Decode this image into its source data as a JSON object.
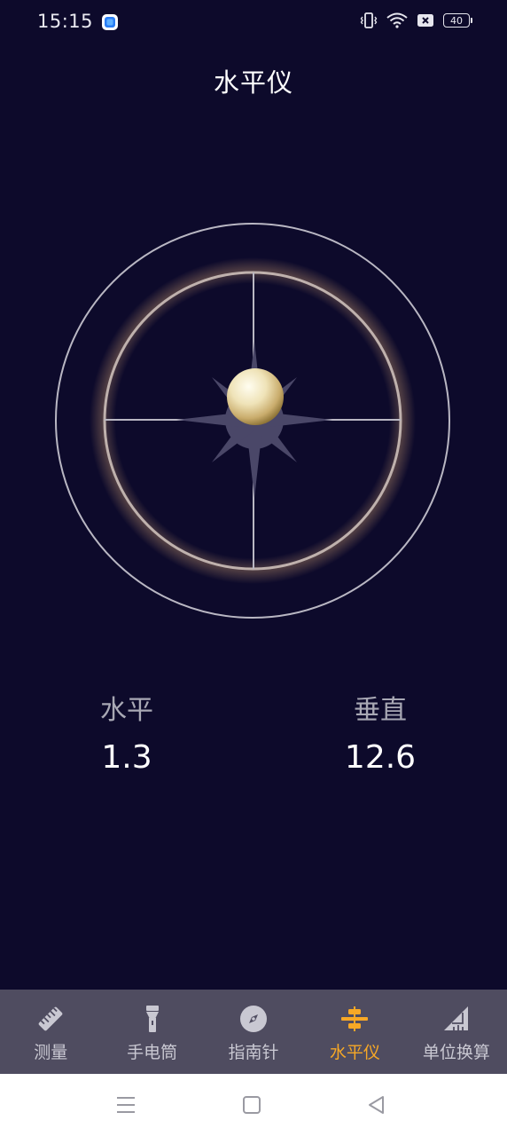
{
  "status_bar": {
    "time": "15:15",
    "battery": "40"
  },
  "page": {
    "title": "水平仪"
  },
  "readouts": {
    "horizontal": {
      "label": "水平",
      "value": "1.3"
    },
    "vertical": {
      "label": "垂直",
      "value": "12.6"
    }
  },
  "tabs": [
    {
      "label": "测量",
      "icon": "ruler-icon",
      "active": false
    },
    {
      "label": "手电筒",
      "icon": "flashlight-icon",
      "active": false
    },
    {
      "label": "指南针",
      "icon": "compass-icon",
      "active": false
    },
    {
      "label": "水平仪",
      "icon": "level-icon",
      "active": true
    },
    {
      "label": "单位换算",
      "icon": "unit-convert-icon",
      "active": false
    }
  ],
  "colors": {
    "background": "#0d0a2b",
    "tab_bar": "#4f4c60",
    "active_tab": "#f7a826",
    "inactive_tab": "#c9c8d2"
  }
}
